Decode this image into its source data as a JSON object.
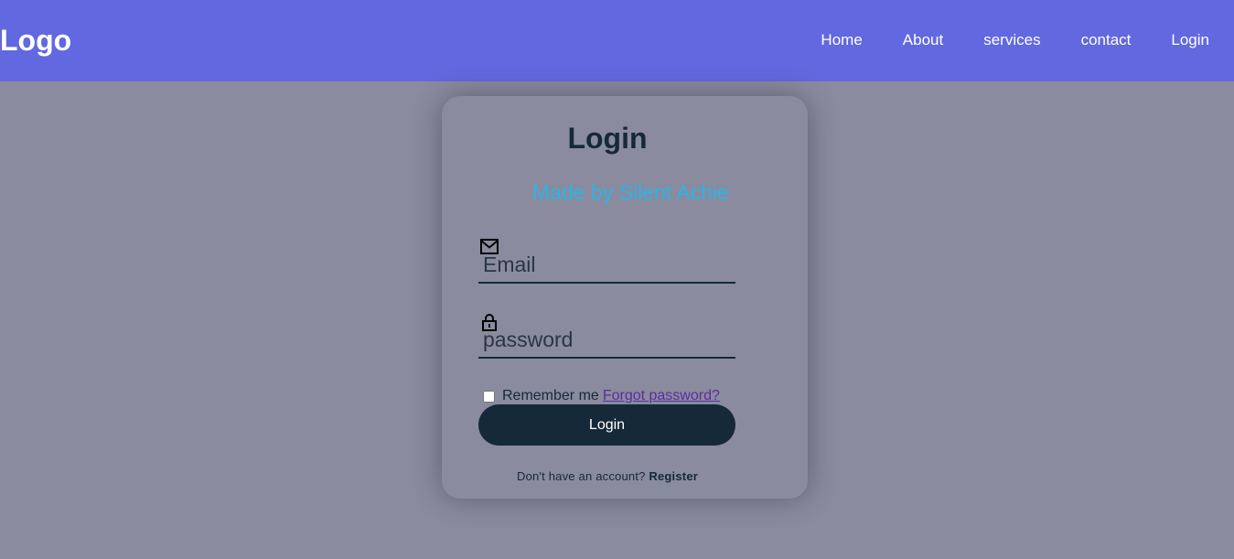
{
  "navbar": {
    "logo": "Logo",
    "links": [
      "Home",
      "About",
      "services",
      "contact",
      "Login"
    ]
  },
  "card": {
    "title": "Login",
    "marquee": "Made by Silent Achie",
    "email": {
      "placeholder": "Email",
      "icon": "mail-icon"
    },
    "password": {
      "placeholder": "password",
      "icon": "lock-icon"
    },
    "remember_label": "Remember me",
    "forgot_link": "Forgot password?",
    "login_button": "Login",
    "register_prompt": "Don't have an account?",
    "register_link": "Register"
  },
  "colors": {
    "navbar": "#6268df",
    "background": "#8a8b9e",
    "button": "#162938",
    "marquee": "#2db4e6",
    "link": "#5a2ca0"
  }
}
